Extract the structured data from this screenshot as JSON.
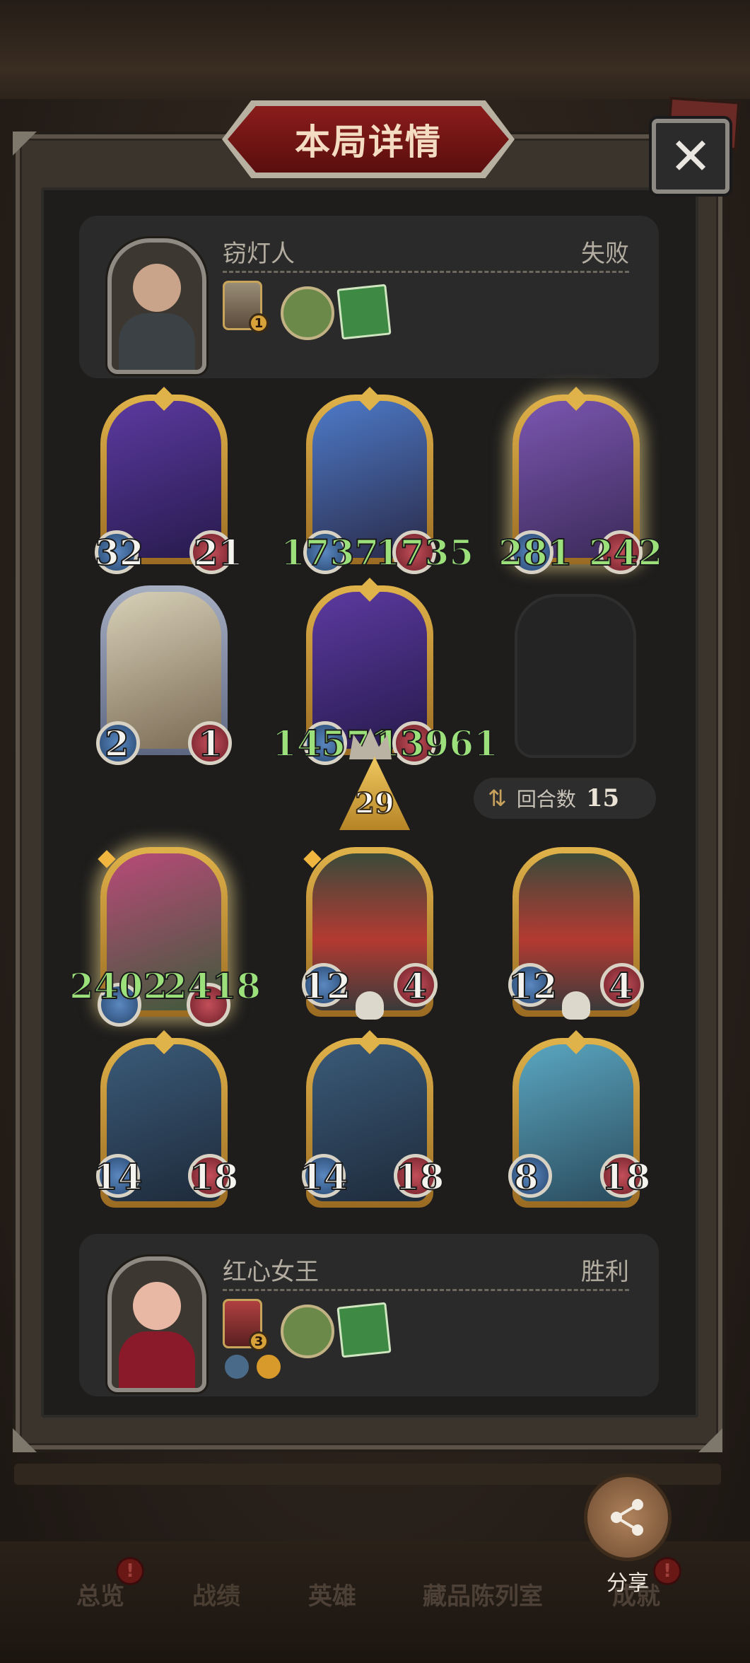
{
  "header": {
    "title": "本局详情",
    "close_icon": "close-icon"
  },
  "top_player": {
    "name": "窃灯人",
    "result": "失败",
    "items": [
      {
        "icon": "hero-token-icon",
        "badge": "1"
      },
      {
        "icon": "witch-spell-icon"
      },
      {
        "icon": "green-book-icon"
      }
    ]
  },
  "board_top": [
    {
      "art": "purple-shark-dragon",
      "atk": "32",
      "hp": "21",
      "buffed": false
    },
    {
      "art": "blue-hair-elf",
      "atk": "1737",
      "hp": "1735",
      "buffed": true
    },
    {
      "art": "bearded-king",
      "atk": "281",
      "hp": "242",
      "buffed": true
    },
    {
      "art": "veiled-priestess",
      "atk": "2",
      "hp": "1",
      "buffed": false
    },
    {
      "art": "purple-shark-dragon",
      "atk": "14571",
      "hp": "13961",
      "buffed": true
    }
  ],
  "tier": {
    "value": "29"
  },
  "rounds": {
    "label": "回合数",
    "value": "15"
  },
  "board_bottom": [
    {
      "art": "rafflesia-girl",
      "atk": "2402",
      "hp": "2418",
      "buffed": true
    },
    {
      "art": "toy-soldier",
      "atk": "12",
      "hp": "4",
      "buffed": false
    },
    {
      "art": "toy-soldier",
      "atk": "12",
      "hp": "4",
      "buffed": false
    },
    {
      "art": "ice-dragon",
      "atk": "14",
      "hp": "18",
      "buffed": false
    },
    {
      "art": "ice-dragon",
      "atk": "14",
      "hp": "18",
      "buffed": false
    },
    {
      "art": "crystal-dragon",
      "atk": "8",
      "hp": "18",
      "buffed": false
    }
  ],
  "bottom_player": {
    "name": "红心女王",
    "result": "胜利",
    "items": [
      {
        "icon": "hero-token-icon",
        "badge": "3"
      },
      {
        "icon": "witch-spell-icon"
      },
      {
        "icon": "green-book-icon"
      }
    ],
    "mini_icons": [
      "sword-icon",
      "horn-icon"
    ]
  },
  "share": {
    "label": "分享"
  },
  "nav": {
    "items": [
      "总览",
      "战绩",
      "英雄",
      "藏品陈列室",
      "成就"
    ],
    "badge": "!"
  },
  "colors": {
    "stat_white": "#f5f3ee",
    "stat_green": "#9be07a",
    "gold_frame": "#e0b24a",
    "banner_red": "#8a1d1b"
  }
}
